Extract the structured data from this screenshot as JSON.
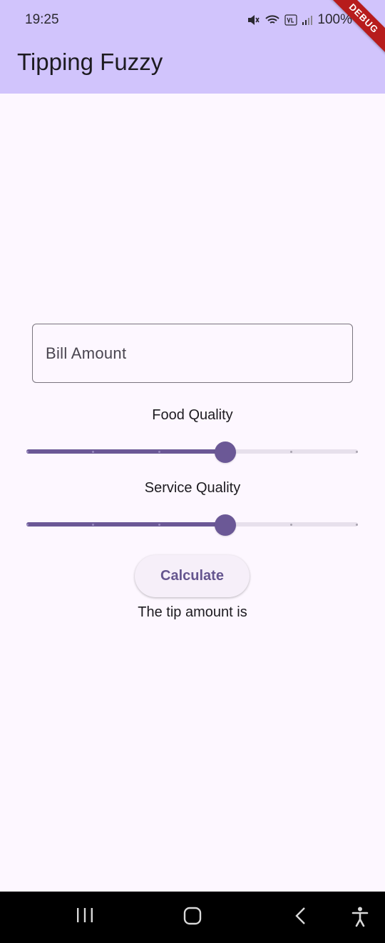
{
  "status_bar": {
    "time": "19:25",
    "battery": "100%",
    "icons": [
      "mute-icon",
      "wifi-icon",
      "volte-icon",
      "signal-icon"
    ]
  },
  "app_bar": {
    "title": "Tipping Fuzzy",
    "background": "#d1c4fc"
  },
  "debug_banner": {
    "label": "DEBUG"
  },
  "form": {
    "bill_field": {
      "placeholder": "Bill Amount",
      "value": ""
    },
    "food_quality": {
      "label": "Food Quality",
      "value_fraction": 0.6,
      "divisions": 5
    },
    "service_quality": {
      "label": "Service Quality",
      "value_fraction": 0.6,
      "divisions": 5
    },
    "calculate_label": "Calculate",
    "result_text": "The tip amount is"
  },
  "colors": {
    "accent": "#6b5896",
    "track_inactive": "#e7e0ec",
    "background": "#fdf7ff"
  },
  "nav_bar": {
    "icons": [
      "recents-icon",
      "home-icon",
      "back-icon",
      "accessibility-icon"
    ]
  }
}
